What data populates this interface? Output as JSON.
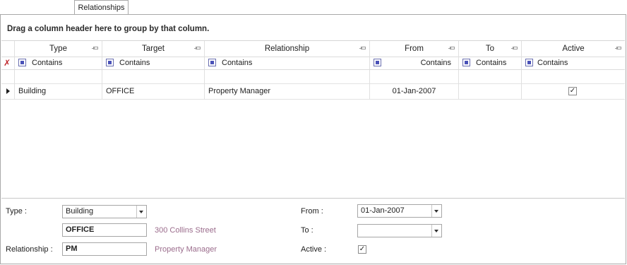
{
  "tab": {
    "label": "Relationships"
  },
  "grid": {
    "group_hint": "Drag a column header here to group by that column.",
    "columns": [
      "Type",
      "Target",
      "Relationship",
      "From",
      "To",
      "Active"
    ],
    "filter_operator": "Contains",
    "rows": [
      {
        "type": "Building",
        "target": "OFFICE",
        "relationship": "Property Manager",
        "from": "01-Jan-2007",
        "to": "",
        "active": true
      }
    ]
  },
  "form": {
    "type_label": "Type :",
    "type_value": "Building",
    "target_code": "OFFICE",
    "target_desc": "300 Collins Street",
    "relationship_label": "Relationship :",
    "relationship_code": "PM",
    "relationship_desc": "Property Manager",
    "from_label": "From :",
    "from_value": "01-Jan-2007",
    "to_label": "To :",
    "to_value": "",
    "active_label": "Active :",
    "active_value": true
  },
  "icons": {
    "check_glyph": "✓"
  }
}
